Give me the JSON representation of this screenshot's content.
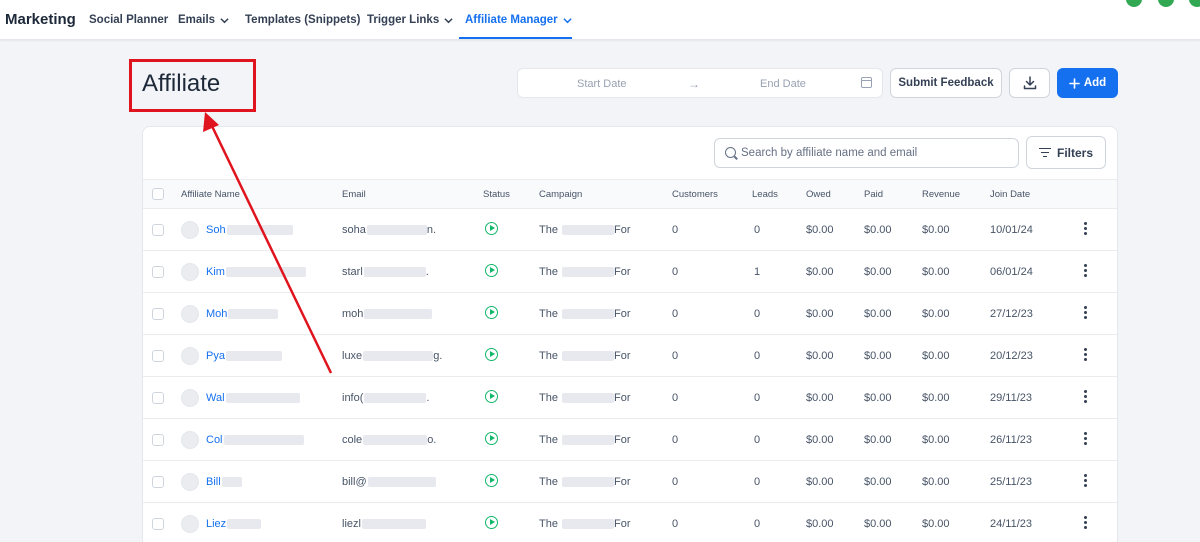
{
  "topnav": {
    "title": "Marketing",
    "items": [
      {
        "label": "Social Planner",
        "dropdown": false,
        "active": false
      },
      {
        "label": "Emails",
        "dropdown": true,
        "active": false
      },
      {
        "label": "Templates (Snippets)",
        "dropdown": false,
        "active": false
      },
      {
        "label": "Trigger Links",
        "dropdown": true,
        "active": false
      },
      {
        "label": "Affiliate Manager",
        "dropdown": true,
        "active": true
      }
    ]
  },
  "header": {
    "title": "Affiliate",
    "date_start_placeholder": "Start Date",
    "date_arrow": "→",
    "date_end_placeholder": "End Date",
    "submit_feedback_label": "Submit Feedback",
    "add_label": "Add"
  },
  "toolbar": {
    "search_placeholder": "Search by affiliate name and email",
    "filters_label": "Filters"
  },
  "table": {
    "columns": [
      "Affiliate Name",
      "Email",
      "Status",
      "Campaign",
      "Customers",
      "Leads",
      "Owed",
      "Paid",
      "Revenue",
      "Join Date"
    ],
    "rows": [
      {
        "name": "Soh",
        "email": "soha",
        "email_suffix": "n.",
        "campaign_prefix": "The",
        "campaign_suffix": "For",
        "customers": "0",
        "leads": "0",
        "owed": "$0.00",
        "paid": "$0.00",
        "revenue": "$0.00",
        "join_date": "10/01/24"
      },
      {
        "name": "Kim",
        "email": "starl",
        "email_suffix": ".",
        "campaign_prefix": "The",
        "campaign_suffix": "For",
        "customers": "0",
        "leads": "1",
        "owed": "$0.00",
        "paid": "$0.00",
        "revenue": "$0.00",
        "join_date": "06/01/24"
      },
      {
        "name": "Moh",
        "email": "moh",
        "email_suffix": "",
        "campaign_prefix": "The",
        "campaign_suffix": "For",
        "customers": "0",
        "leads": "0",
        "owed": "$0.00",
        "paid": "$0.00",
        "revenue": "$0.00",
        "join_date": "27/12/23"
      },
      {
        "name": "Pya",
        "email": "luxe",
        "email_suffix": "g.",
        "campaign_prefix": "The",
        "campaign_suffix": "For",
        "customers": "0",
        "leads": "0",
        "owed": "$0.00",
        "paid": "$0.00",
        "revenue": "$0.00",
        "join_date": "20/12/23"
      },
      {
        "name": "Wal",
        "email": "info(",
        "email_suffix": ".",
        "campaign_prefix": "The",
        "campaign_suffix": "For",
        "customers": "0",
        "leads": "0",
        "owed": "$0.00",
        "paid": "$0.00",
        "revenue": "$0.00",
        "join_date": "29/11/23"
      },
      {
        "name": "Col",
        "email": "cole",
        "email_suffix": "o.",
        "campaign_prefix": "The",
        "campaign_suffix": "For",
        "customers": "0",
        "leads": "0",
        "owed": "$0.00",
        "paid": "$0.00",
        "revenue": "$0.00",
        "join_date": "26/11/23"
      },
      {
        "name": "Bill",
        "email": "bill@",
        "email_suffix": "",
        "campaign_prefix": "The",
        "campaign_suffix": "For",
        "customers": "0",
        "leads": "0",
        "owed": "$0.00",
        "paid": "$0.00",
        "revenue": "$0.00",
        "join_date": "25/11/23"
      },
      {
        "name": "Liez",
        "email": "liezl",
        "email_suffix": "",
        "campaign_prefix": "The",
        "campaign_suffix": "For",
        "customers": "0",
        "leads": "0",
        "owed": "$0.00",
        "paid": "$0.00",
        "revenue": "$0.00",
        "join_date": "24/11/23"
      }
    ]
  },
  "colors": {
    "accent": "#1570ef",
    "status_active": "#12b76a",
    "annotation": "#e0141e"
  },
  "icons": [
    "chevron-down-icon",
    "calendar-icon",
    "download-icon",
    "plus-icon",
    "search-icon",
    "filter-icon",
    "play-circle-icon",
    "more-vertical-icon"
  ]
}
